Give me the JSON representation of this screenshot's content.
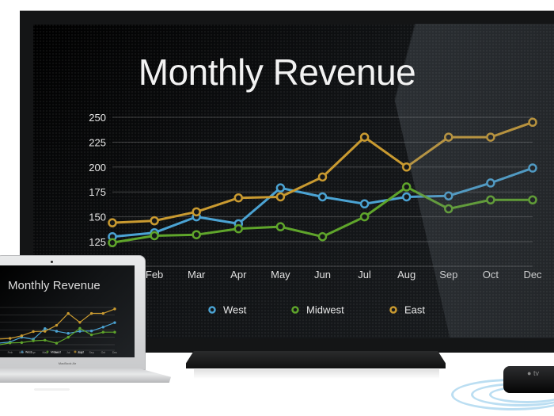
{
  "scene": {
    "laptop_brand_label": "MacBook Air",
    "set_top_box_logo": "tv",
    "wireless_waves_color": "#8cc8ec"
  },
  "chart_data": {
    "type": "line",
    "title": "Monthly Revenue",
    "xlabel": "",
    "ylabel": "",
    "categories": [
      "Jan",
      "Feb",
      "Mar",
      "Apr",
      "May",
      "Jun",
      "Jul",
      "Aug",
      "Sep",
      "Oct",
      "Dec"
    ],
    "x_tick_labels_visible": [
      "Feb",
      "Mar",
      "Apr",
      "May",
      "Jun",
      "Jul",
      "Aug",
      "Sep",
      "Oct",
      "Dec"
    ],
    "y_ticks": [
      125,
      150,
      175,
      200,
      225,
      250
    ],
    "ylim": [
      125,
      250
    ],
    "grid": true,
    "legend_position": "bottom",
    "series": [
      {
        "name": "West",
        "color": "#4ba3d3",
        "values": [
          130,
          134,
          150,
          143,
          179,
          170,
          163,
          170,
          171,
          184,
          199
        ]
      },
      {
        "name": "Midwest",
        "color": "#5fa52b",
        "values": [
          124,
          131,
          132,
          138,
          140,
          130,
          150,
          180,
          158,
          167,
          167
        ]
      },
      {
        "name": "East",
        "color": "#c99a30",
        "values": [
          144,
          146,
          155,
          169,
          170,
          190,
          230,
          200,
          230,
          230,
          245
        ]
      }
    ]
  }
}
